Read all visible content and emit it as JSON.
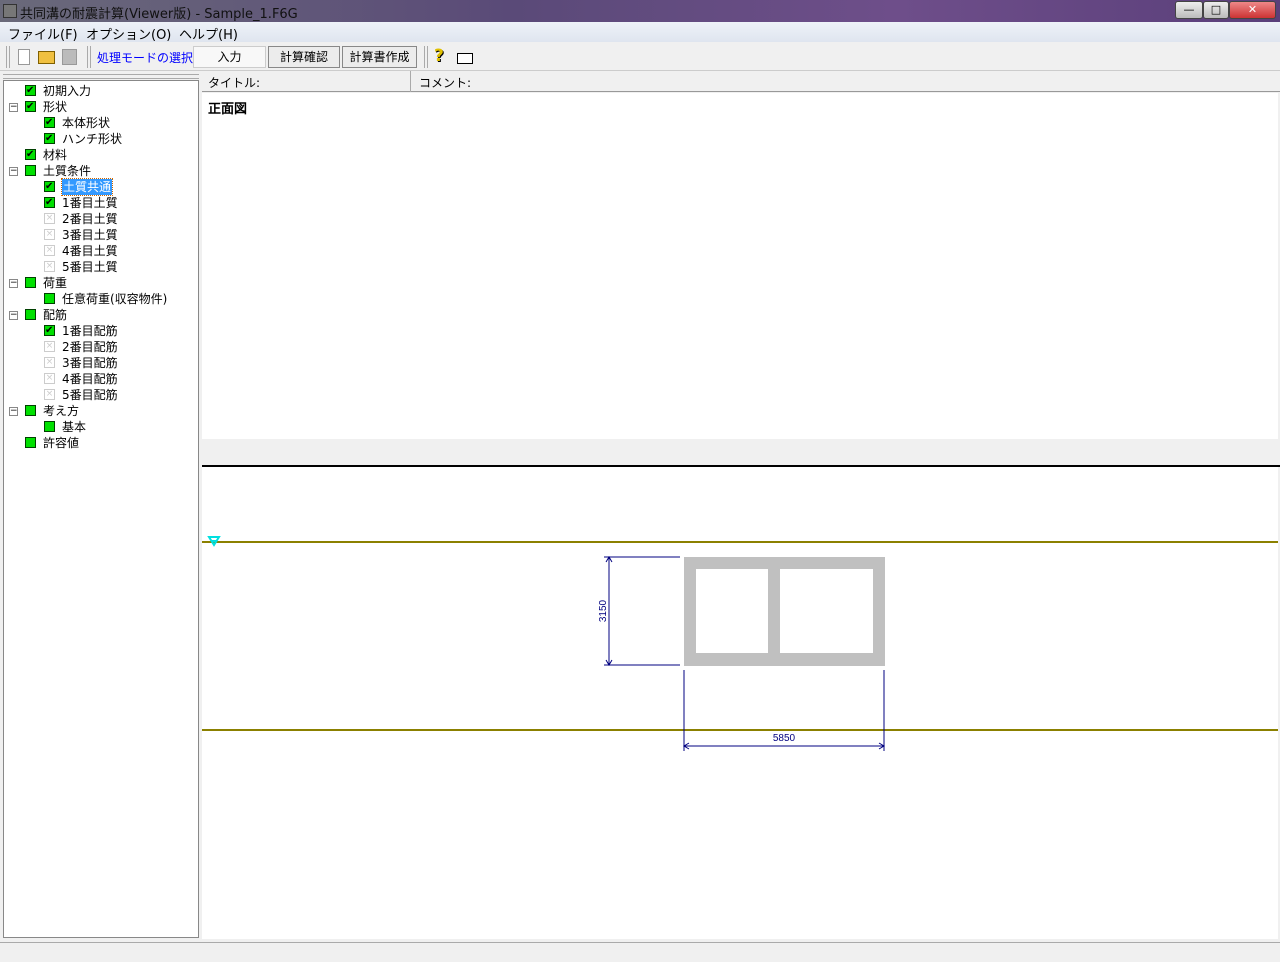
{
  "window": {
    "title": "共同溝の耐震計算(Viewer版) - Sample_1.F6G",
    "min": "—",
    "max": "□",
    "close": "✕"
  },
  "menu": [
    "ファイル(F)",
    "オプション(O)",
    "ヘルプ(H)"
  ],
  "toolbar": {
    "mode_label": "処理モードの選択",
    "modes": [
      "入力",
      "計算確認",
      "計算書作成"
    ],
    "help": "?"
  },
  "tree": [
    {
      "label": "初期入力",
      "level": 0,
      "state": "checked"
    },
    {
      "label": "形状",
      "level": 0,
      "state": "checked",
      "expander": "−"
    },
    {
      "label": "本体形状",
      "level": 1,
      "state": "checked"
    },
    {
      "label": "ハンチ形状",
      "level": 1,
      "state": "checked"
    },
    {
      "label": "材料",
      "level": 0,
      "state": "checked"
    },
    {
      "label": "土質条件",
      "level": 0,
      "state": "green",
      "expander": "−"
    },
    {
      "label": "土質共通",
      "level": 1,
      "state": "checked",
      "selected": true
    },
    {
      "label": "1番目土質",
      "level": 1,
      "state": "checked"
    },
    {
      "label": "2番目土質",
      "level": 1,
      "state": "disabled"
    },
    {
      "label": "3番目土質",
      "level": 1,
      "state": "disabled"
    },
    {
      "label": "4番目土質",
      "level": 1,
      "state": "disabled"
    },
    {
      "label": "5番目土質",
      "level": 1,
      "state": "disabled"
    },
    {
      "label": "荷重",
      "level": 0,
      "state": "green",
      "expander": "−"
    },
    {
      "label": "任意荷重(収容物件)",
      "level": 1,
      "state": "green"
    },
    {
      "label": "配筋",
      "level": 0,
      "state": "green",
      "expander": "−"
    },
    {
      "label": "1番目配筋",
      "level": 1,
      "state": "checked"
    },
    {
      "label": "2番目配筋",
      "level": 1,
      "state": "disabled"
    },
    {
      "label": "3番目配筋",
      "level": 1,
      "state": "disabled"
    },
    {
      "label": "4番目配筋",
      "level": 1,
      "state": "disabled"
    },
    {
      "label": "5番目配筋",
      "level": 1,
      "state": "disabled"
    },
    {
      "label": "考え方",
      "level": 0,
      "state": "green",
      "expander": "−"
    },
    {
      "label": "基本",
      "level": 1,
      "state": "green"
    },
    {
      "label": "許容値",
      "level": 0,
      "state": "green"
    }
  ],
  "header": {
    "title_label": "タイトル:",
    "comment_label": "コメント:"
  },
  "upper": {
    "heading": "正面図"
  },
  "drawing": {
    "height_dim": "3150",
    "width_dim": "5850",
    "colors": {
      "ground": "#8b8000",
      "dim": "#000080",
      "section": "#c0c0c0",
      "water": "#00e0e0"
    }
  }
}
